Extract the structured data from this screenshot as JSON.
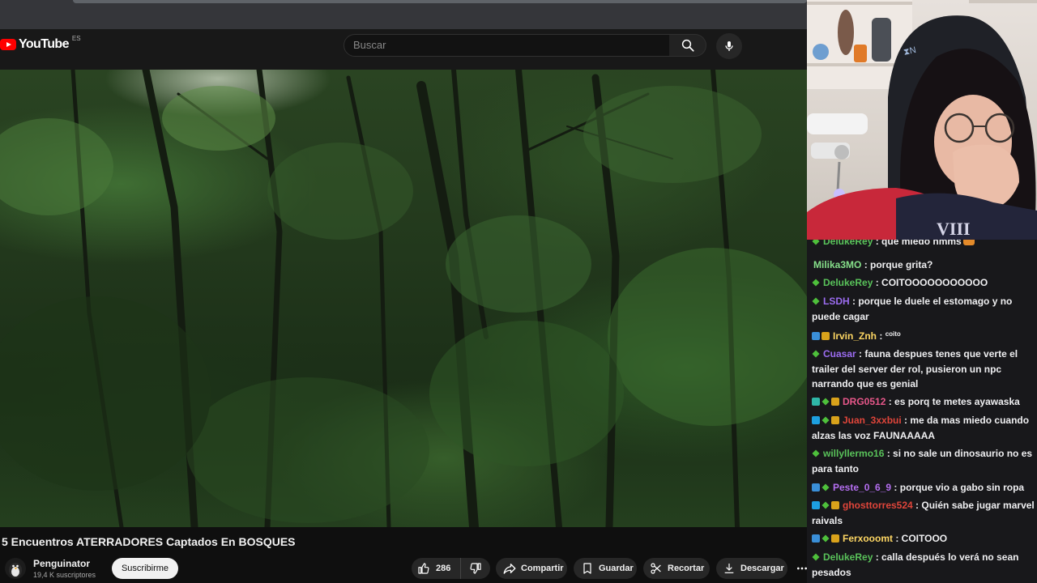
{
  "youtube": {
    "logo_text": "YouTube",
    "region": "ES",
    "search_placeholder": "Buscar",
    "video_title": "5 Encuentros ATERRADORES Captados En BOSQUES",
    "channel": {
      "name": "Penguinator",
      "subscribers": "19,4 K suscriptores",
      "subscribe_label": "Suscribirme"
    },
    "actions": {
      "likes": "286",
      "share": "Compartir",
      "save": "Guardar",
      "clip": "Recortar",
      "download": "Descargar"
    }
  },
  "chat": {
    "messages": [
      {
        "user": "DelukeRey",
        "color": "#59c25a",
        "text": ": que miedo hmms",
        "badges": [
          "green"
        ]
      },
      {
        "user": "Milika3MO",
        "color": "#86e08a",
        "text": ": porque grita?",
        "badges": []
      },
      {
        "user": "DelukeRey",
        "color": "#59c25a",
        "text": ": COITOOOOOOOOOOO",
        "badges": [
          "green"
        ]
      },
      {
        "user": "LSDH",
        "color": "#9b6cf0",
        "text": ": porque le duele el estomago y no puede cagar",
        "badges": [
          "green"
        ]
      },
      {
        "user": "Irvin_Znh",
        "color": "#fdd663",
        "text": ": ",
        "extra": "coito",
        "badges": [
          "blue",
          "gold"
        ]
      },
      {
        "user": "Cuasar",
        "color": "#9b6cf0",
        "text": ": fauna despues tenes que verte el trailer del server der rol, pusieron un npc narrando que es genial",
        "badges": [
          "green"
        ]
      },
      {
        "user": "DRG0512",
        "color": "#e7578a",
        "text": ": es porq te metes ayawaska",
        "badges": [
          "teal",
          "green",
          "gold"
        ]
      },
      {
        "user": "Juan_3xxbui",
        "color": "#e0453a",
        "text": ": me da mas miedo cuando alzas las voz FAUNAAAAA",
        "badges": [
          "cyan",
          "green",
          "gold"
        ]
      },
      {
        "user": "willyllermo16",
        "color": "#59c25a",
        "text": ": si no sale un dinosaurio no es para tanto",
        "badges": [
          "green"
        ]
      },
      {
        "user": "Peste_0_6_9",
        "color": "#b46ef0",
        "text": ": porque vio a gabo sin ropa",
        "badges": [
          "blue",
          "green"
        ]
      },
      {
        "user": "ghosttorres524",
        "color": "#e0453a",
        "text": ": Quién sabe jugar marvel raivals",
        "badges": [
          "cyan",
          "green",
          "gold"
        ]
      },
      {
        "user": "Ferxooomt",
        "color": "#fdd663",
        "text": ": COITOOO",
        "badges": [
          "blue",
          "green",
          "gold"
        ]
      },
      {
        "user": "DelukeRey",
        "color": "#59c25a",
        "text": ": calla después lo verá no sean pesados",
        "badges": [
          "green"
        ]
      }
    ]
  }
}
